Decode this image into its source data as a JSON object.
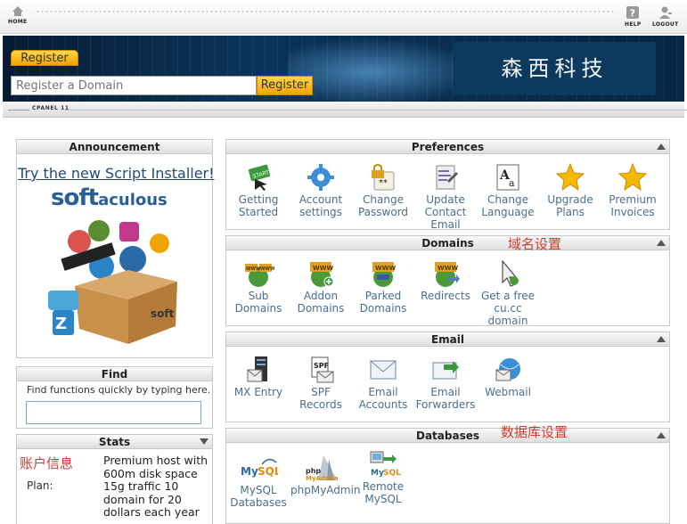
{
  "topbar": {
    "home": "HOME",
    "help": "HELP",
    "logout": "LOGOUT"
  },
  "banner": {
    "register_tab": "Register",
    "domain_placeholder": "Register a Domain",
    "register_button": "Register",
    "brand": "森西科技"
  },
  "cpanel_label": "CPANEL 11",
  "announcement": {
    "title": "Announcement",
    "link": "Try the new Script Installer!",
    "logo_main": "soft",
    "logo_rest": "aculous"
  },
  "find": {
    "title": "Find",
    "hint": "Find functions quickly by typing here.",
    "value": ""
  },
  "stats": {
    "title": "Stats",
    "annotation": "账户信息",
    "plan_label": "Plan:",
    "plan_value": "Premium host with 600m disk space 15g traffic 10 domain for 20 dollars each year"
  },
  "preferences": {
    "title": "Preferences",
    "items": [
      {
        "label": "Getting\nStarted",
        "icon": "start-icon"
      },
      {
        "label": "Account\nsettings",
        "icon": "gear-icon"
      },
      {
        "label": "Change\nPassword",
        "icon": "lock-icon"
      },
      {
        "label": "Update\nContact\nEmail",
        "icon": "contact-icon"
      },
      {
        "label": "Change\nLanguage",
        "icon": "language-icon"
      },
      {
        "label": "Upgrade\nPlans",
        "icon": "star-icon"
      },
      {
        "label": "Premium\nInvoices",
        "icon": "star-icon"
      }
    ]
  },
  "domains": {
    "title": "Domains",
    "annotation": "域名设置",
    "items": [
      {
        "label": "Sub\nDomains",
        "icon": "www-icon"
      },
      {
        "label": "Addon\nDomains",
        "icon": "www-add-icon"
      },
      {
        "label": "Parked\nDomains",
        "icon": "www-parked-icon"
      },
      {
        "label": "Redirects",
        "icon": "www-redirect-icon"
      },
      {
        "label": "Get a free\ncu.cc\ndomain",
        "icon": "cursor-icon"
      }
    ]
  },
  "email": {
    "title": "Email",
    "items": [
      {
        "label": "MX Entry",
        "icon": "server-icon"
      },
      {
        "label": "SPF\nRecords",
        "icon": "spf-icon"
      },
      {
        "label": "Email\nAccounts",
        "icon": "envelope-icon"
      },
      {
        "label": "Email\nForwarders",
        "icon": "forward-icon"
      },
      {
        "label": "Webmail",
        "icon": "webmail-icon"
      }
    ]
  },
  "databases": {
    "title": "Databases",
    "annotation": "数据库设置",
    "items": [
      {
        "label": "MySQL\nDatabases",
        "icon": "mysql-icon"
      },
      {
        "label": "phpMyAdmin",
        "icon": "phpmyadmin-icon"
      },
      {
        "label": "Remote\nMySQL",
        "icon": "remote-mysql-icon"
      }
    ]
  },
  "colors": {
    "accent": "#f0a400",
    "link": "#1f4a7a",
    "icon_label": "#4a6f8c",
    "annotation": "#d43a2f",
    "banner": "#0b3358"
  }
}
